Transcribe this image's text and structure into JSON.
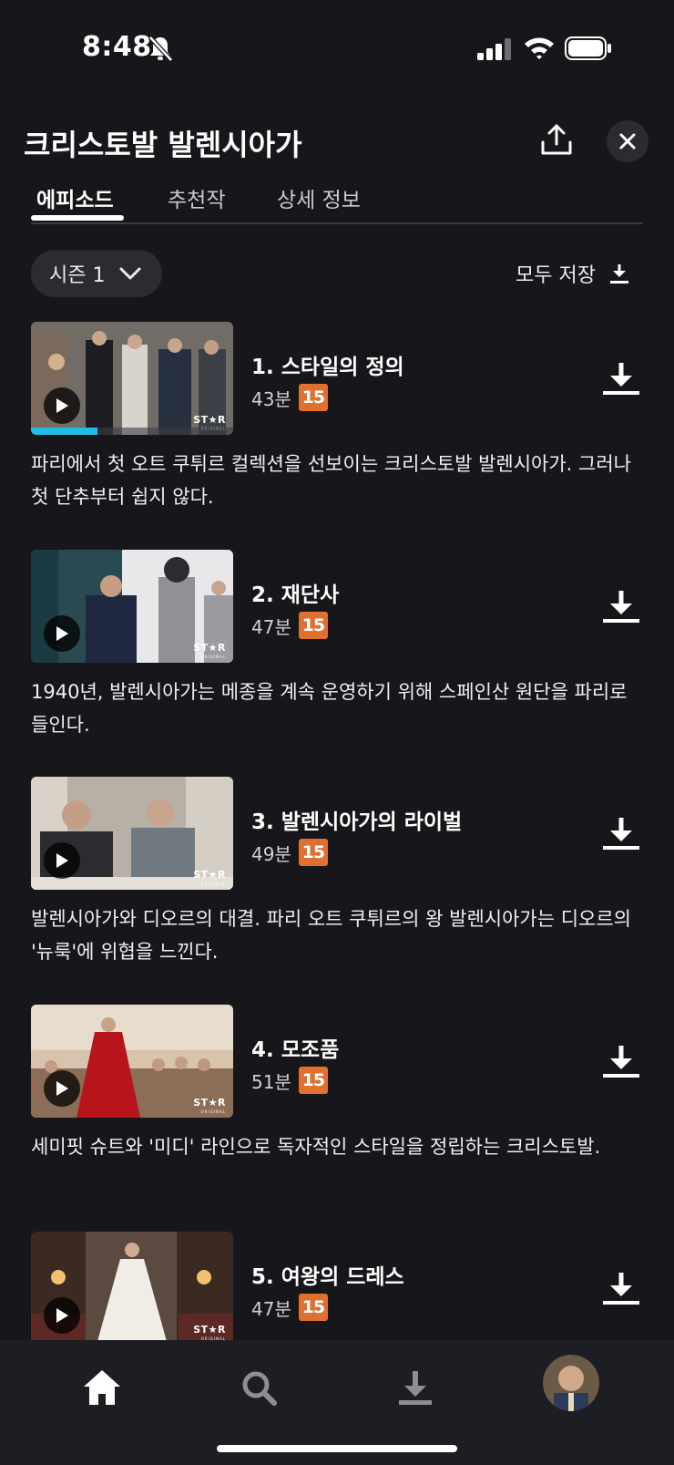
{
  "status_bar": {
    "time": "8:48"
  },
  "header": {
    "title": "크리스토발 발렌시아가"
  },
  "tabs": [
    {
      "label": "에피소드",
      "active": true
    },
    {
      "label": "추천작",
      "active": false
    },
    {
      "label": "상세 정보",
      "active": false
    }
  ],
  "season": {
    "selected": "시즌 1"
  },
  "download_all": {
    "label": "모두 저장"
  },
  "thumbnail_badge": {
    "brand": "ST★R",
    "sub": "ORIGINAL"
  },
  "episodes": [
    {
      "title": "1. 스타일의 정의",
      "duration": "43분",
      "rating": "15",
      "progress": 0.33,
      "description": "파리에서 첫 오트 쿠튀르 컬렉션을 선보이는 크리스토발 발렌시아가. 그러나 첫 단추부터 쉽지 않다."
    },
    {
      "title": "2. 재단사",
      "duration": "47분",
      "rating": "15",
      "description": "1940년, 발렌시아가는 메종을 계속 운영하기 위해 스페인산 원단을 파리로 들인다."
    },
    {
      "title": "3. 발렌시아가의 라이벌",
      "duration": "49분",
      "rating": "15",
      "description": "발렌시아가와 디오르의 대결. 파리 오트 쿠튀르의 왕 발렌시아가는 디오르의 '뉴룩'에 위협을 느낀다."
    },
    {
      "title": "4. 모조품",
      "duration": "51분",
      "rating": "15",
      "description": "세미핏 슈트와 '미디' 라인으로 독자적인 스타일을 정립하는 크리스토발."
    },
    {
      "title": "5. 여왕의 드레스",
      "duration": "47분",
      "rating": "15",
      "description": ""
    }
  ],
  "colors": {
    "background": "#16161b",
    "rating_badge": "#e0702f",
    "progress": "#20bde4",
    "nav_bar": "#1d1d24"
  },
  "bottom_nav": [
    "home-icon",
    "search-icon",
    "downloads-icon",
    "profile-avatar"
  ]
}
